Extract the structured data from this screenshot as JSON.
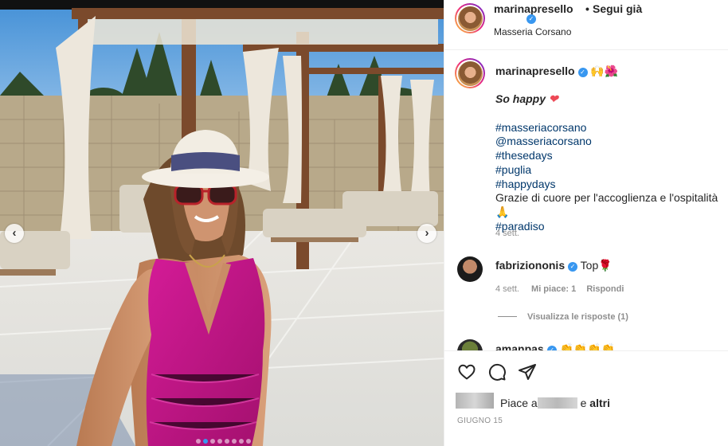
{
  "post": {
    "author": "marinapresello",
    "follow_label": "Segui già",
    "location": "Masseria Corsano",
    "carousel": {
      "slide_count": 8,
      "active_index": 1
    },
    "nav_prev_glyph": "‹",
    "nav_next_glyph": "›"
  },
  "caption": {
    "author": "marinapresello",
    "emoji": "🙌🌺",
    "happy": "So happy",
    "happy_emoji": "❤",
    "lines": [
      {
        "text": "#masseriacorsano",
        "kind": "tag"
      },
      {
        "text": "@masseriacorsano",
        "kind": "tag"
      },
      {
        "text": "#thesedays",
        "kind": "tag"
      },
      {
        "text": "#puglia",
        "kind": "tag"
      },
      {
        "text": "#happydays",
        "kind": "tag"
      },
      {
        "text": "Grazie di cuore per l'accoglienza e l'ospitalità 🙏",
        "kind": "plain"
      },
      {
        "text": "#paradiso",
        "kind": "tag"
      }
    ],
    "time": "4 sett."
  },
  "comment": {
    "author": "fabriziononis",
    "text": "Top",
    "emoji": "🌹",
    "time": "4 sett.",
    "likes": "Mi piace: 1",
    "reply": "Rispondi",
    "view_replies": "Visualizza le risposte (1)"
  },
  "next_comment": {
    "author": "amanpas",
    "emoji": "👏👏👏👏"
  },
  "actions": {
    "like_icon": "heart-icon",
    "comment_icon": "comment-icon",
    "share_icon": "share-icon",
    "likes_prefix": "Piace a",
    "likes_suffix": "e",
    "likes_others": "altri",
    "date": "GIUGNO 15"
  },
  "colors": {
    "link": "#00376b",
    "verified": "#3897f0",
    "muted": "#8e8e8e",
    "swimsuit": "#c8168a",
    "pergola": "#7b4a2c"
  }
}
